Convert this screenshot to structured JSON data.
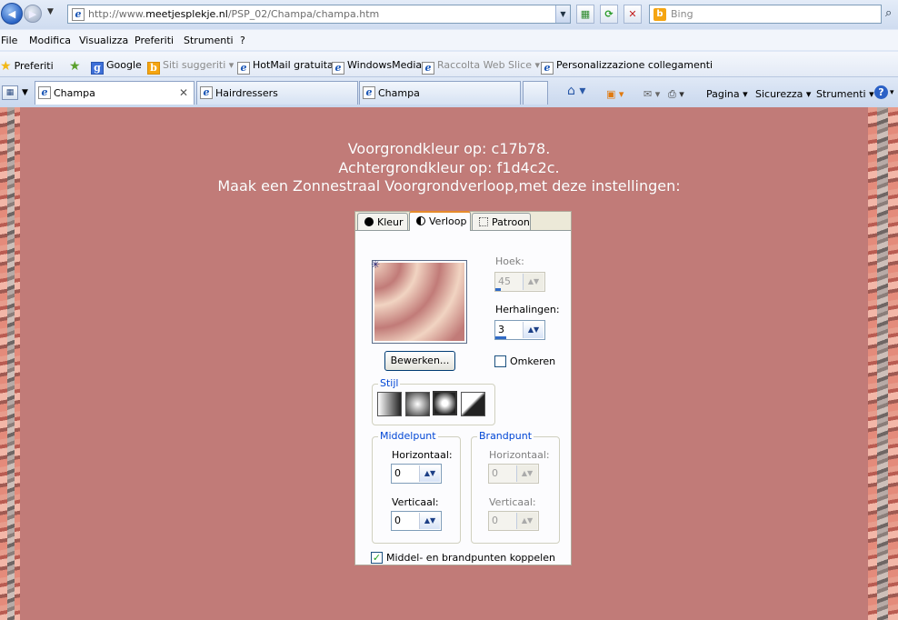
{
  "browser": {
    "address": {
      "prefix": "http://www.",
      "domain": "meetjesplekje.nl",
      "path": "/PSP_02/Champa/champa.htm"
    },
    "search_placeholder": "Bing",
    "menu": [
      "File",
      "Modifica",
      "Visualizza",
      "Preferiti",
      "Strumenti",
      "?"
    ],
    "favorites_label": "Preferiti",
    "favorites": [
      {
        "label": "Google",
        "icon": "google-icon"
      },
      {
        "label": "Siti suggeriti ▾",
        "icon": "suggested-sites-icon"
      },
      {
        "label": "HotMail gratuita",
        "icon": "ie-page-icon"
      },
      {
        "label": "WindowsMedia",
        "icon": "ie-page-icon"
      },
      {
        "label": "Raccolta Web Slice ▾",
        "icon": "ie-page-icon"
      },
      {
        "label": "Personalizzazione collegamenti",
        "icon": "ie-page-icon"
      }
    ],
    "tabs": [
      {
        "label": "Champa",
        "active": true
      },
      {
        "label": "Hairdressers",
        "active": false
      },
      {
        "label": "Champa",
        "active": false
      }
    ],
    "commands": {
      "page": "Pagina ▾",
      "security": "Sicurezza ▾",
      "tools": "Strumenti ▾"
    }
  },
  "content": {
    "line1": "Voorgrondkleur op: c17b78.",
    "line2": "Achtergrondkleur op: f1d4c2c.",
    "line3": "Maak een Zonnestraal Voorgrondverloop,met deze instellingen:",
    "colors": {
      "foreground": "#c17b78",
      "background": "#f1d4c2"
    }
  },
  "dialog": {
    "tabs": [
      "Kleur",
      "Verloop",
      "Patroon"
    ],
    "angle_label": "Hoek:",
    "angle_value": "45",
    "repeats_label": "Herhalingen:",
    "repeats_value": "3",
    "edit_button": "Bewerken...",
    "invert_label": "Omkeren",
    "style_label": "Stijl",
    "center_group": "Middelpunt",
    "focal_group": "Brandpunt",
    "horizontal_label": "Horizontaal:",
    "vertical_label": "Verticaal:",
    "center_h": "0",
    "center_v": "0",
    "focal_h": "0",
    "focal_v": "0",
    "link_label": "Middel- en brandpunten koppelen"
  }
}
